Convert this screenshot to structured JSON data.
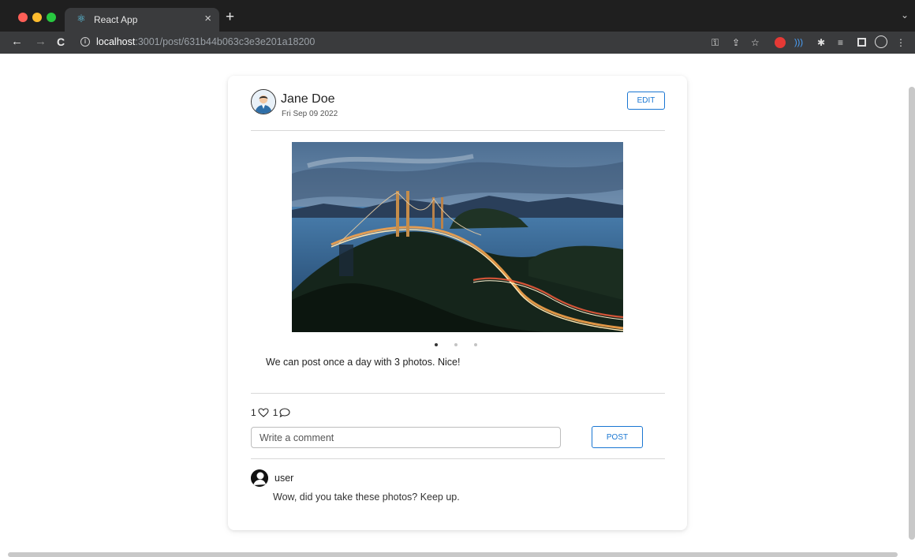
{
  "browser": {
    "tab_title": "React App",
    "tab_close": "×",
    "new_tab": "+",
    "tab_menu": "⌄",
    "nav": {
      "back": "←",
      "forward": "→",
      "reload": "C"
    },
    "url_host": "localhost",
    "url_rest": ":3001/post/631b44b063c3e3e201a18200",
    "extension_icons": [
      "key-icon",
      "share-icon",
      "star-icon",
      "adblock-icon",
      "sound-icon",
      "puzzle-icon",
      "reading-list-icon",
      "side-panel-icon",
      "profile-icon",
      "more-icon"
    ]
  },
  "post": {
    "author": "Jane Doe",
    "date": "Fri Sep 09 2022",
    "edit_label": "EDIT",
    "caption": "We can post once a day with 3 photos. Nice!",
    "photo_count": 3,
    "active_photo_index": 0,
    "likes": "1",
    "comments_count": "1"
  },
  "comment_form": {
    "placeholder": "Write a comment",
    "value": "",
    "submit_label": "POST"
  },
  "comments": [
    {
      "user": "user",
      "text": "Wow, did you take these photos? Keep up."
    }
  ],
  "colors": {
    "accent": "#1976d2",
    "chrome_dark": "#1f1f1f",
    "toolbar": "#3a3b3d"
  }
}
